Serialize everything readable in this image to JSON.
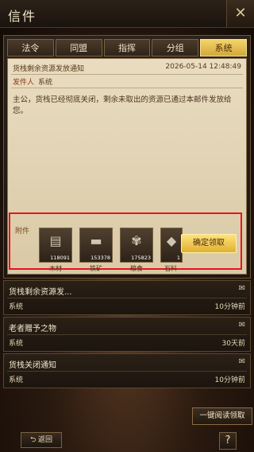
{
  "window": {
    "title": "信件",
    "close_icon": "close-icon"
  },
  "tabs": [
    {
      "label": "法令",
      "active": false
    },
    {
      "label": "同盟",
      "active": false
    },
    {
      "label": "指挥",
      "active": false
    },
    {
      "label": "分组",
      "active": false
    },
    {
      "label": "系统",
      "active": true
    }
  ],
  "mail": {
    "subject": "货栈剩余资源发放通知",
    "date": "2026-05-14 12:48:49",
    "sender_label": "发件人",
    "sender": "系统",
    "body": "主公，货栈已经彻底关闭，剩余未取出的资源已通过本邮件发放给您。",
    "attachment_label": "附件",
    "attachments": [
      {
        "name": "木材",
        "qty": "118091",
        "icon": "wood-icon"
      },
      {
        "name": "铁矿",
        "qty": "153378",
        "icon": "iron-ore-icon"
      },
      {
        "name": "粮食",
        "qty": "175823",
        "icon": "grain-icon"
      },
      {
        "name": "石料",
        "qty": "1",
        "icon": "stone-icon"
      }
    ],
    "claim_label": "确定领取"
  },
  "list": [
    {
      "title": "货栈剩余资源发...",
      "sender": "系统",
      "time": "10分钟前",
      "icon": "open-envelope-icon"
    },
    {
      "title": "老者赠予之物",
      "sender": "系统",
      "time": "30天前",
      "icon": "envelope-icon"
    },
    {
      "title": "货栈关闭通知",
      "sender": "系统",
      "time": "10分钟前",
      "icon": "envelope-icon"
    }
  ],
  "footer": {
    "read_all_label": "一键阅读领取",
    "back_label": "返回",
    "help_label": "?"
  },
  "colors": {
    "active_tab": "#e8be4a",
    "highlight_box": "#e8141a",
    "claim_button": "#f0c850"
  }
}
